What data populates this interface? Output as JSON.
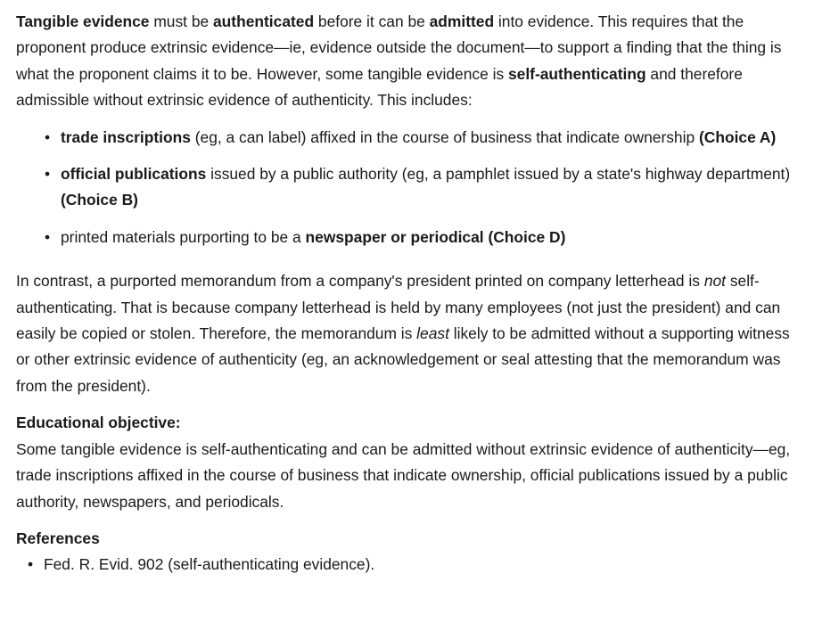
{
  "intro": {
    "t1": "Tangible evidence",
    "t2": " must be ",
    "t3": "authenticated",
    "t4": " before it can be ",
    "t5": "admitted",
    "t6": " into evidence.  This requires that the proponent produce extrinsic evidence—ie, evidence outside the document—to support a finding that the thing is what the proponent claims it to be.  However, some tangible evidence is ",
    "t7": "self-authenticating",
    "t8": " and therefore admissible without extrinsic evidence of authenticity.  This includes:"
  },
  "bullet_glyph": "•",
  "items": [
    {
      "bold": "trade inscriptions",
      "text": " (eg, a can label) affixed in the course of business that indicate ownership ",
      "choice": "(Choice A)"
    },
    {
      "bold": "official publications",
      "text": " issued by a public authority (eg, a pamphlet issued by a state's highway department) ",
      "choice": "(Choice B)"
    },
    {
      "text": "printed materials purporting to be a ",
      "bold": "newspaper or periodical",
      "choice": " (Choice D)"
    }
  ],
  "contrast": {
    "t1": "In contrast, a purported memorandum from a company's president printed on company letterhead is ",
    "t2": "not",
    "t3": " self-authenticating.  That is because company letterhead is held by many employees (not just the president) and can easily be copied or stolen.  Therefore, the memorandum is ",
    "t4": "least",
    "t5": " likely to be admitted without a supporting witness or other extrinsic evidence of authenticity (eg, an acknowledgement or seal attesting that the memorandum was from the president)."
  },
  "educational_objective": {
    "heading": "Educational objective:",
    "text": "Some tangible evidence is self-authenticating and can be admitted without extrinsic evidence of authenticity—eg, trade inscriptions affixed in the course of business that indicate ownership, official publications issued by a public authority, newspapers, and periodicals."
  },
  "references": {
    "heading": "References",
    "items": [
      "Fed. R. Evid. 902 (self-authenticating evidence)."
    ]
  }
}
